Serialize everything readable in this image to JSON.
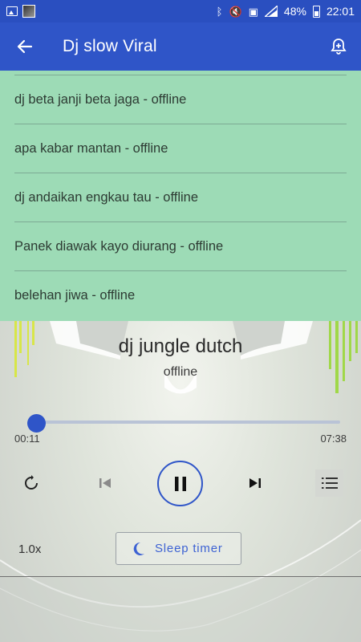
{
  "status_bar": {
    "battery": "48%",
    "time": "22:01",
    "icons": [
      "image-icon",
      "app-avatar-icon",
      "bluetooth-icon",
      "mute-icon",
      "nfc-icon",
      "signal-icon",
      "battery-icon"
    ]
  },
  "app_bar": {
    "title": "Dj slow Viral",
    "back_icon": "arrow-back-icon",
    "action_icon": "ringtone-bell-icon"
  },
  "playlist": {
    "items": [
      {
        "label": "dj beta janji beta jaga - offline"
      },
      {
        "label": "apa kabar mantan - offline"
      },
      {
        "label": "dj andaikan engkau tau - offline"
      },
      {
        "label": "Panek diawak kayo diurang - offline"
      },
      {
        "label": "belehan jiwa - offline"
      }
    ]
  },
  "now_playing": {
    "title": "dj jungle dutch",
    "subtitle": "offline",
    "current_time": "00:11",
    "total_time": "07:38",
    "progress": 0.024
  },
  "controls": {
    "speed": "1.0x",
    "sleep_timer": "Sleep timer"
  },
  "colors": {
    "primary": "#2f55c8",
    "playlist_bg": "#9ddbb6",
    "accent_text": "#3d62d3"
  }
}
